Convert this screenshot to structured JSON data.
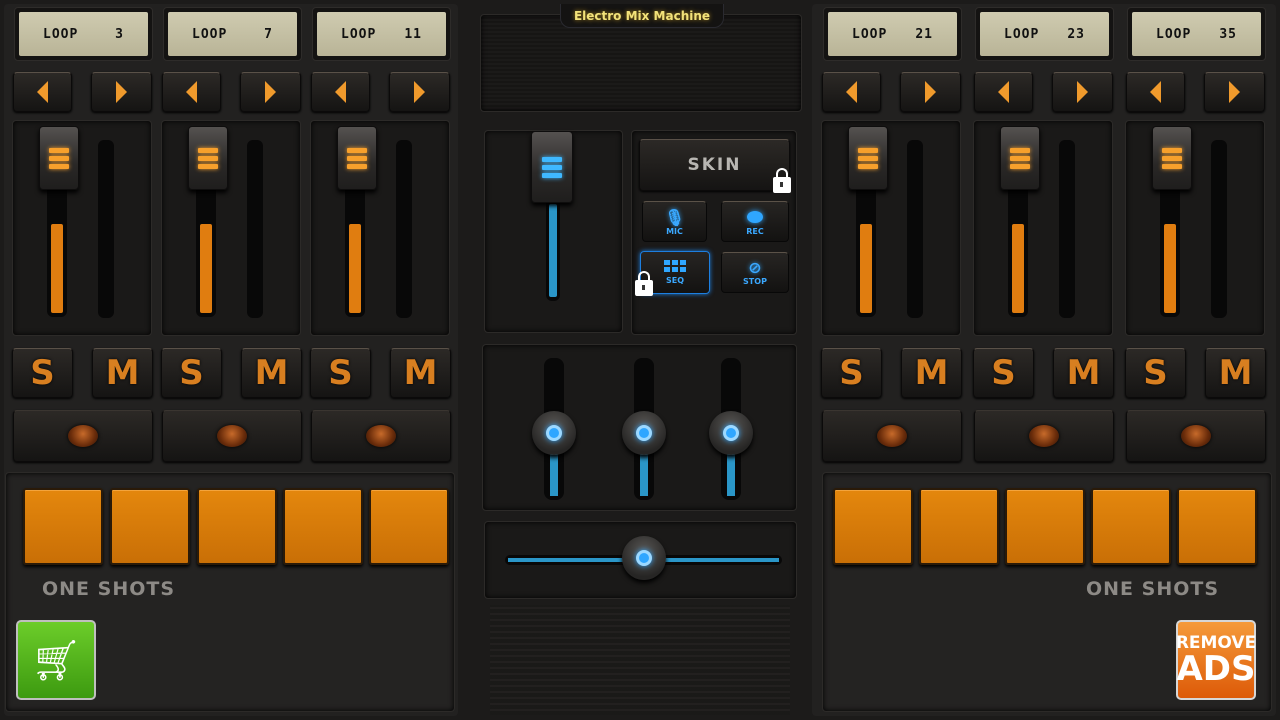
{
  "app_title": "Electro Mix Machine",
  "left_deck": {
    "channels": [
      {
        "loop_label": "LOOP",
        "loop_number": "3",
        "solo": "S",
        "mute": "M",
        "volume": 0.72
      },
      {
        "loop_label": "LOOP",
        "loop_number": "7",
        "solo": "S",
        "mute": "M",
        "volume": 0.72
      },
      {
        "loop_label": "LOOP",
        "loop_number": "11",
        "solo": "S",
        "mute": "M",
        "volume": 0.72
      }
    ],
    "one_shots_label": "ONE SHOTS",
    "pad_count": 5
  },
  "right_deck": {
    "channels": [
      {
        "loop_label": "LOOP",
        "loop_number": "21",
        "solo": "S",
        "mute": "M",
        "volume": 0.72
      },
      {
        "loop_label": "LOOP",
        "loop_number": "23",
        "solo": "S",
        "mute": "M",
        "volume": 0.72
      },
      {
        "loop_label": "LOOP",
        "loop_number": "35",
        "solo": "S",
        "mute": "M",
        "volume": 0.72
      }
    ],
    "one_shots_label": "ONE SHOTS",
    "pad_count": 5
  },
  "center": {
    "master_volume": 0.95,
    "skin_label": "SKIN",
    "mic_label": "MIC",
    "rec_label": "REC",
    "seq_label": "SEQ",
    "stop_label": "STOP",
    "eq_levels": [
      0.5,
      0.5,
      0.5
    ],
    "crossfader": 0.5
  },
  "remove_ads": {
    "line1": "REMOVE",
    "line2": "ADS"
  },
  "colors": {
    "accent": "#e07d10",
    "blue": "#2fa6ff",
    "title": "#f2e27a"
  }
}
